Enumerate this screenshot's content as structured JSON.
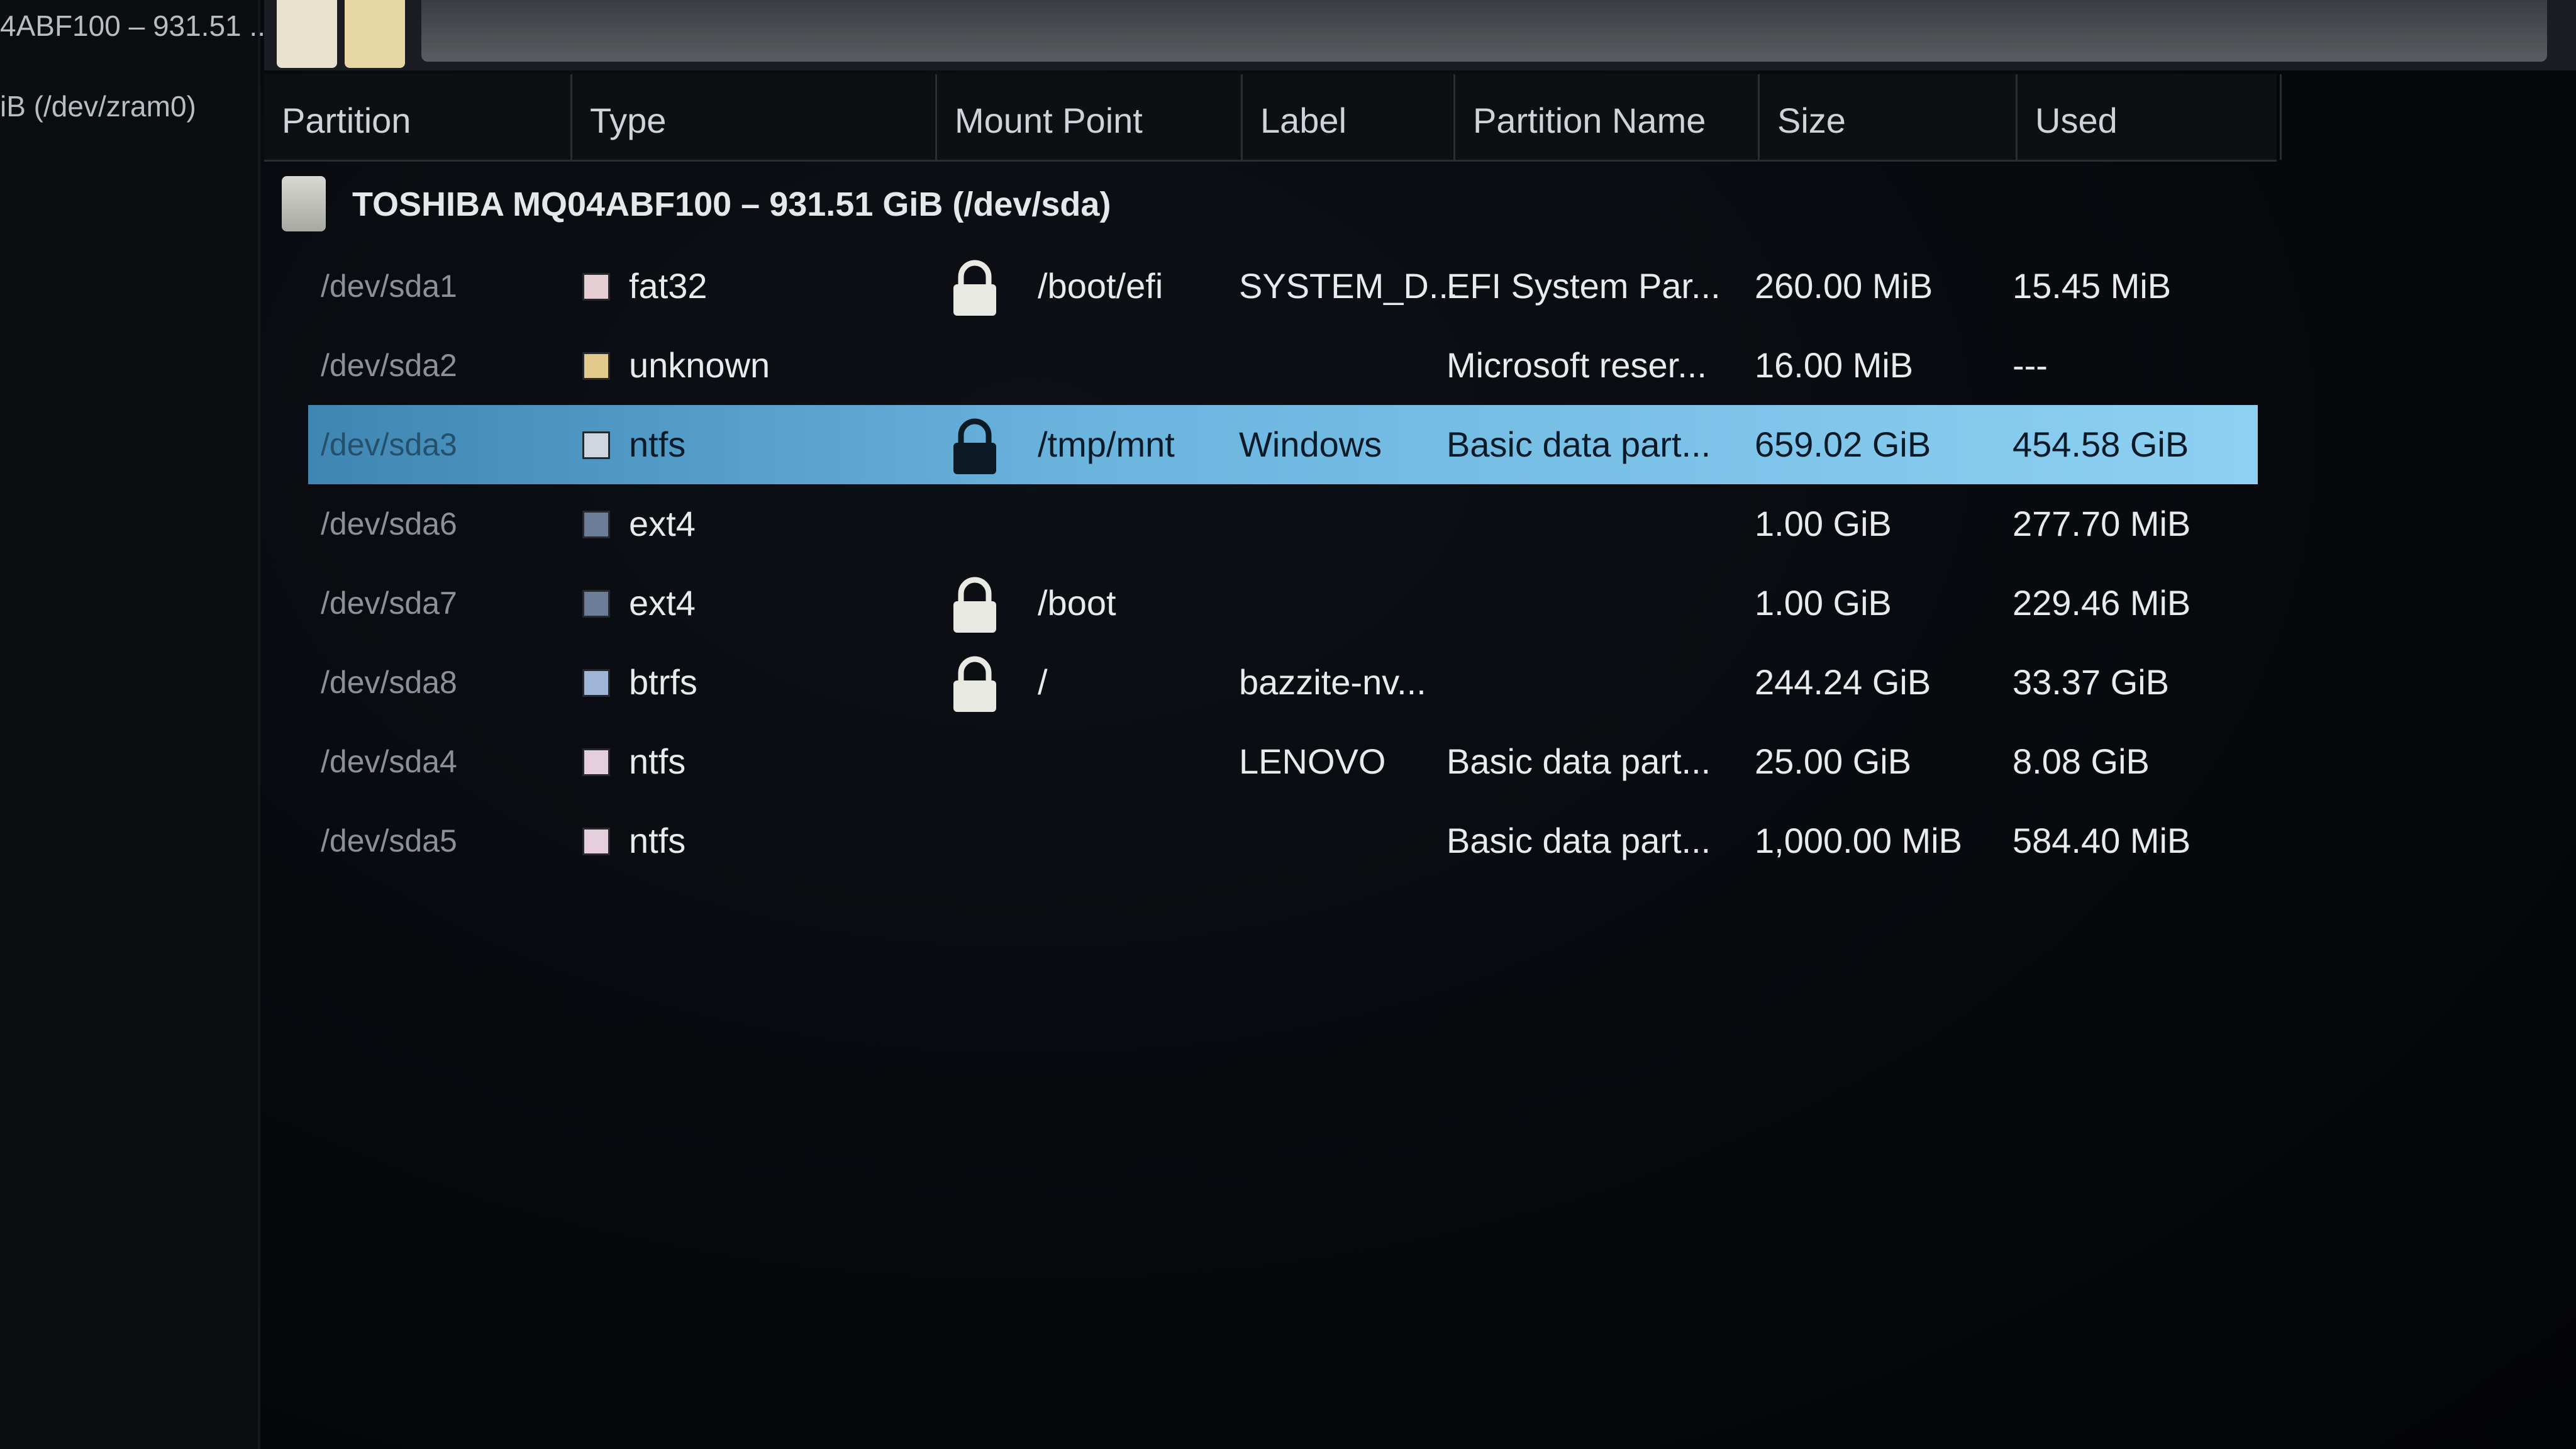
{
  "sidebar": {
    "items": [
      "4ABF100 – 931.51 ...",
      "iB (/dev/zram0)"
    ]
  },
  "toolbar": {
    "swatch_colors": [
      "#e8e2cf",
      "#e6d7a4"
    ]
  },
  "columns": [
    "Partition",
    "Type",
    "Mount Point",
    "Label",
    "Partition Name",
    "Size",
    "Used"
  ],
  "device": {
    "title": "TOSHIBA MQ04ABF100 – 931.51 GiB (/dev/sda)"
  },
  "partitions": [
    {
      "partition": "/dev/sda1",
      "type": "fat32",
      "type_color": "#e6cfd4",
      "mount": "/boot/efi",
      "locked": true,
      "label": "SYSTEM_D...",
      "name": "EFI System Par...",
      "size": "260.00 MiB",
      "used": "15.45 MiB"
    },
    {
      "partition": "/dev/sda2",
      "type": "unknown",
      "type_color": "#e2c98c",
      "mount": "",
      "locked": false,
      "label": "",
      "name": "Microsoft reser...",
      "size": "16.00 MiB",
      "used": "---"
    },
    {
      "partition": "/dev/sda3",
      "type": "ntfs",
      "type_color": "#cfd6e0",
      "mount": "/tmp/mnt",
      "locked": true,
      "label": "Windows",
      "name": "Basic data part...",
      "size": "659.02 GiB",
      "used": "454.58 GiB",
      "selected": true
    },
    {
      "partition": "/dev/sda6",
      "type": "ext4",
      "type_color": "#6c7e97",
      "mount": "",
      "locked": false,
      "label": "",
      "name": "",
      "size": "1.00 GiB",
      "used": "277.70 MiB"
    },
    {
      "partition": "/dev/sda7",
      "type": "ext4",
      "type_color": "#6c7e97",
      "mount": "/boot",
      "locked": true,
      "label": "",
      "name": "",
      "size": "1.00 GiB",
      "used": "229.46 MiB"
    },
    {
      "partition": "/dev/sda8",
      "type": "btrfs",
      "type_color": "#9fb6d6",
      "mount": "/",
      "locked": true,
      "label": "bazzite-nv...",
      "name": "",
      "size": "244.24 GiB",
      "used": "33.37 GiB"
    },
    {
      "partition": "/dev/sda4",
      "type": "ntfs",
      "type_color": "#e6cfdc",
      "mount": "",
      "locked": false,
      "label": "LENOVO",
      "name": "Basic data part...",
      "size": "25.00 GiB",
      "used": "8.08 GiB"
    },
    {
      "partition": "/dev/sda5",
      "type": "ntfs",
      "type_color": "#e6cfdc",
      "mount": "",
      "locked": false,
      "label": "",
      "name": "Basic data part...",
      "size": "1,000.00 MiB",
      "used": "584.40 MiB"
    }
  ]
}
